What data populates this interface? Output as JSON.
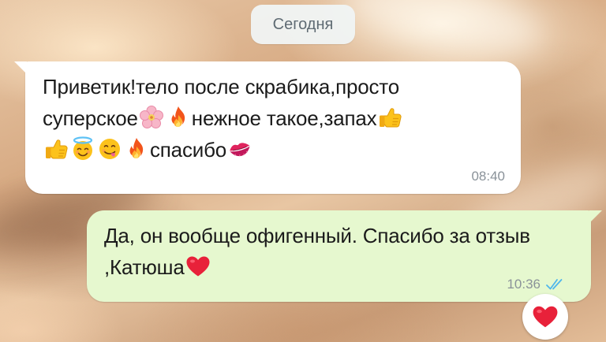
{
  "date_separator": "Сегодня",
  "incoming": {
    "parts": [
      "Приветик!тело после скрабика,просто суперское",
      "нежное такое,запах",
      "спасибо"
    ],
    "time": "08:40",
    "emojis": [
      "cherry-blossom",
      "fire",
      "thumbs-up",
      "thumbs-up",
      "smiling-face-with-halo",
      "face-savoring-food",
      "fire",
      "kiss-mark"
    ]
  },
  "outgoing": {
    "parts": [
      "Да, он вообще офигенный. Спасибо за отзыв ,Катюша"
    ],
    "time": "10:36",
    "status": "read",
    "emojis": [
      "red-heart"
    ]
  },
  "reaction": {
    "emoji": "red-heart"
  },
  "colors": {
    "incoming_bubble": "#ffffff",
    "outgoing_bubble": "#e6f8cf",
    "read_ticks": "#4fb6ec",
    "timestamp": "#8a9299",
    "date_chip": "#f0f4f4"
  }
}
